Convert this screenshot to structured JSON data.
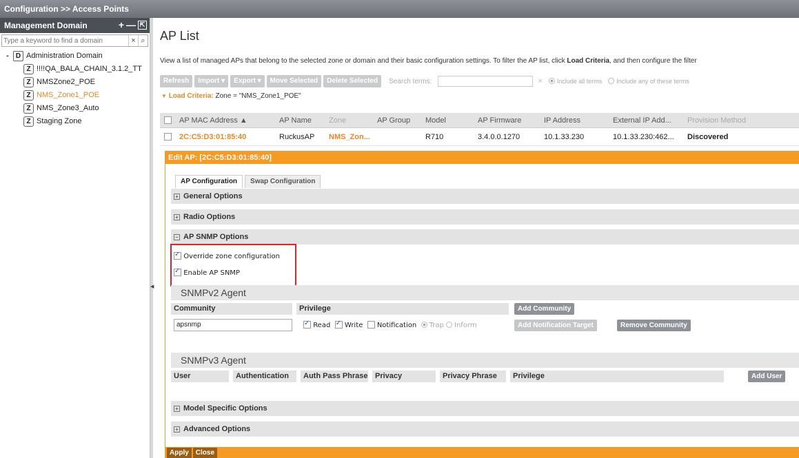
{
  "topbar": {
    "breadcrumb": "Configuration >> Access Points"
  },
  "sidebar": {
    "title": "Management Domain",
    "add": "+",
    "remove": "—",
    "search_placeholder": "Type a keyword to find a domain",
    "root": {
      "toggle": "-",
      "badge": "D",
      "label": "Administration Domain"
    },
    "zones": [
      {
        "badge": "Z",
        "label": "!!!!QA_BALA_CHAIN_3.1.2_TT"
      },
      {
        "badge": "Z",
        "label": "NMSZone2_POE"
      },
      {
        "badge": "Z",
        "label": "NMS_Zone1_POE"
      },
      {
        "badge": "Z",
        "label": "NMS_Zone3_Auto"
      },
      {
        "badge": "Z",
        "label": "Staging Zone"
      }
    ]
  },
  "main": {
    "title": "AP List",
    "desc_pre": "View a list of managed APs that belong to the selected zone or domain and their basic configuration settings. To filter the AP list, click",
    "desc_bold": "Load Criteria",
    "desc_post": ", and then configure the filter",
    "toolbar": {
      "refresh": "Refresh",
      "import": "Import",
      "export": "Export",
      "move": "Move Selected",
      "delete": "Delete Selected",
      "search_label": "Search terms:",
      "include_all": "Include all terms",
      "include_any": "Include any of these terms"
    },
    "load_criteria_label": "Load Criteria:",
    "load_criteria_value": "Zone = \"NMS_Zone1_POE\"",
    "grid": {
      "headers": [
        "AP MAC Address ▲",
        "AP Name",
        "Zone",
        "AP Group",
        "Model",
        "AP Firmware",
        "IP Address",
        "External IP Add...",
        "Provision Method"
      ],
      "row": [
        "2C:C5:D3:01:85:40",
        "RuckusAP",
        "NMS_Zon...",
        "",
        "R710",
        "3.4.0.0.1270",
        "10.1.33.230",
        "10.1.33.230:462...",
        "Discovered"
      ]
    }
  },
  "edit": {
    "title": "Edit AP: [2C:C5:D3:01:85:40]",
    "tabs": [
      "AP Configuration",
      "Swap Configuration"
    ],
    "sections": {
      "general": "General Options",
      "radio": "Radio Options",
      "snmp": "AP SNMP Options",
      "model": "Model Specific Options",
      "advanced": "Advanced Options"
    },
    "override": "Override zone configuration",
    "enable_snmp": "Enable AP SNMP",
    "snmpv2": {
      "title": "SNMPv2 Agent",
      "community_header": "Community",
      "privilege_header": "Privilege",
      "add_community": "Add Community",
      "add_target": "Add Notification Target",
      "remove_community": "Remove Community",
      "community_value": "apsnmp",
      "read": "Read",
      "write": "Write",
      "notification": "Notification",
      "trap": "Trap",
      "inform": "Inform"
    },
    "snmpv3": {
      "title": "SNMPv3 Agent",
      "headers": [
        "User",
        "Authentication",
        "Auth Pass Phrase",
        "Privacy",
        "Privacy Phrase",
        "Privilege"
      ],
      "add_user": "Add User"
    },
    "apply": "Apply",
    "close": "Close"
  }
}
